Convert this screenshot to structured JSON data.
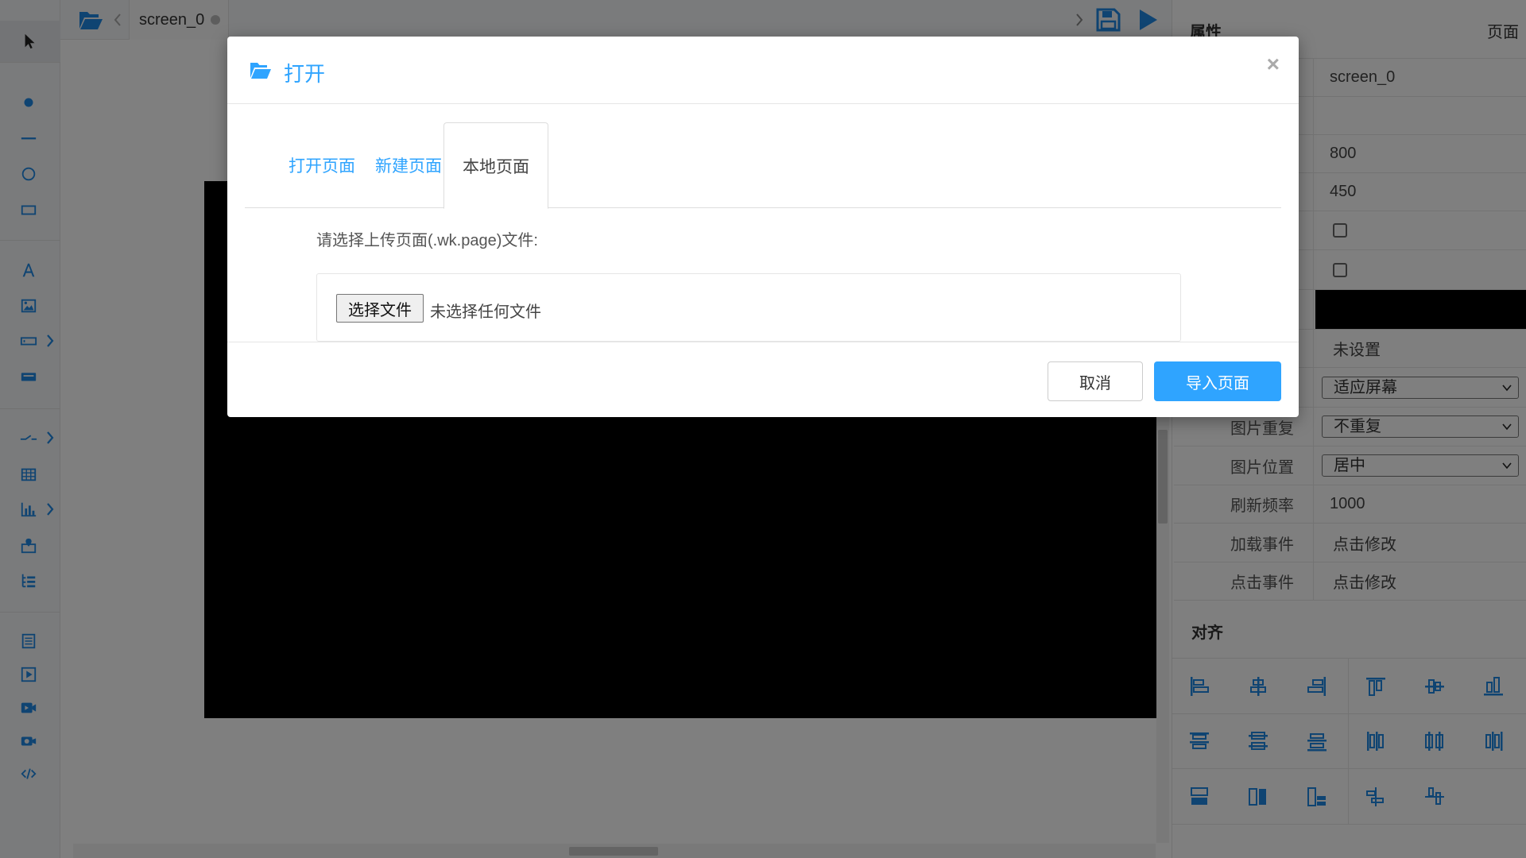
{
  "topbar": {
    "tab_label": "screen_0"
  },
  "right_panel": {
    "header_title": "属性",
    "header_right": "页面",
    "name_value": "screen_0",
    "width_value": "800",
    "height_value": "450",
    "bg_image_value": "未设置",
    "image_size_select": "适应屏幕",
    "image_repeat_label": "图片重复",
    "image_repeat_select": "不重复",
    "image_position_label": "图片位置",
    "image_position_select": "居中",
    "refresh_label": "刷新频率",
    "refresh_value": "1000",
    "load_event_label": "加载事件",
    "load_event_value": "点击修改",
    "click_event_label": "点击事件",
    "click_event_value": "点击修改",
    "align_title": "对齐"
  },
  "modal": {
    "title": "打开",
    "close_glyph": "×",
    "tabs": [
      {
        "label": "打开页面",
        "active": false
      },
      {
        "label": "新建页面",
        "active": false
      },
      {
        "label": "本地页面",
        "active": true
      }
    ],
    "upload_label": "请选择上传页面(.wk.page)文件:",
    "file_button": "选择文件",
    "file_status": "未选择任何文件",
    "cancel_label": "取消",
    "import_label": "导入页面"
  },
  "colors": {
    "accent": "#2fa4ff",
    "toolbar_icon": "#1e88e5",
    "overlay": "rgba(0,0,0,0.5)",
    "canvas_bg": "#000000"
  },
  "icons": {
    "toolbar": [
      "pointer-icon",
      "dot-icon",
      "line-icon",
      "circle-icon",
      "rectangle-icon",
      "text-icon",
      "image-icon",
      "input-icon",
      "button-icon",
      "switch-icon",
      "table-icon",
      "chart-icon",
      "map-pin-icon",
      "tree-list-icon",
      "document-icon",
      "play-box-icon",
      "video-icon",
      "camera-icon",
      "code-icon"
    ],
    "topbar": [
      "folder-open-icon",
      "chevron-left-icon",
      "chevron-right-icon",
      "save-icon",
      "play-icon"
    ]
  }
}
